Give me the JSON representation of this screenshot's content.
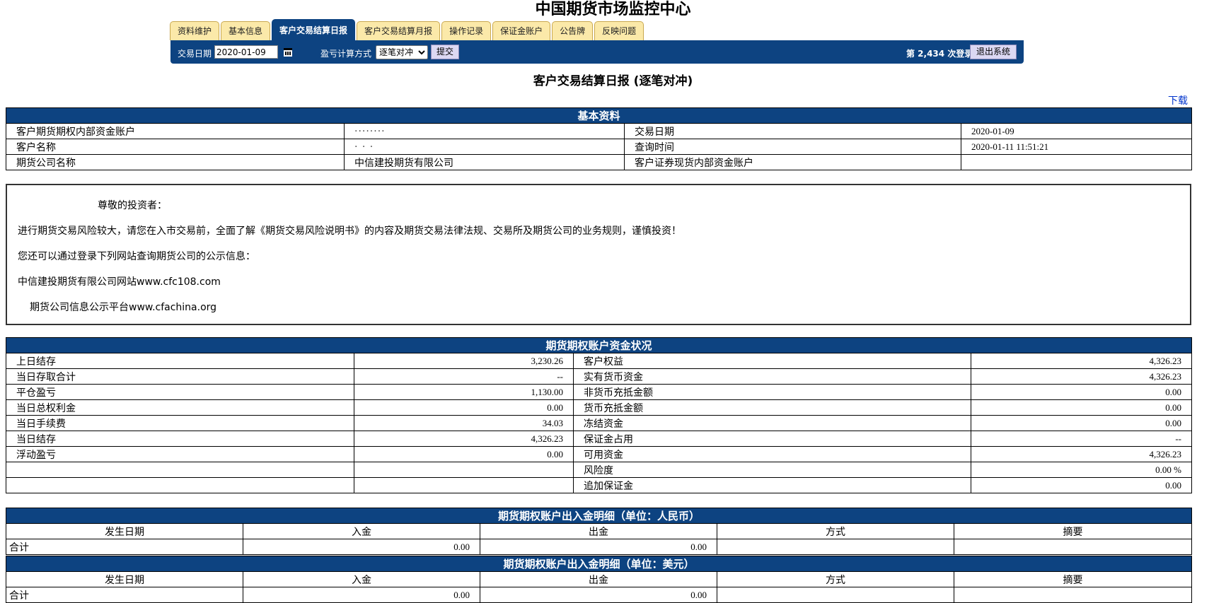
{
  "header": {
    "site_title": "中国期货市场监控中心"
  },
  "tabs": [
    {
      "label": "资料维护"
    },
    {
      "label": "基本信息"
    },
    {
      "label": "客户交易结算日报"
    },
    {
      "label": "客户交易结算月报"
    },
    {
      "label": "操作记录"
    },
    {
      "label": "保证金账户"
    },
    {
      "label": "公告牌"
    },
    {
      "label": "反映问题"
    }
  ],
  "toolbar": {
    "date_label": "交易日期",
    "date_value": "2020-01-09",
    "calc_label": "盈亏计算方式",
    "calc_value": "逐笔对冲",
    "submit_label": "提交",
    "login_count": "第 2,434 次登录",
    "logout_label": "退出系统"
  },
  "report": {
    "title": "客户交易结算日报 (逐笔对冲)",
    "download": "下载"
  },
  "basic": {
    "title": "基本资料",
    "rows": [
      {
        "l1": "客户期货期权内部资金账户",
        "v1": "········",
        "l2": "交易日期",
        "v2": "2020-01-09"
      },
      {
        "l1": "客户名称",
        "v1": "· · ·",
        "l2": "查询时间",
        "v2": "2020-01-11 11:51:21"
      },
      {
        "l1": "期货公司名称",
        "v1": "中信建投期货有限公司",
        "l2": "客户证券现货内部资金账户",
        "v2": ""
      }
    ]
  },
  "notice": {
    "greeting": "尊敬的投资者：",
    "line1": "进行期货交易风险较大，请您在入市交易前，全面了解《期货交易风险说明书》的内容及期货交易法律法规、交易所及期货公司的业务规则，谨慎投资！",
    "line2": "您还可以通过登录下列网站查询期货公司的公示信息：",
    "line3": "中信建投期货有限公司网站www.cfc108.com",
    "line4": "期货公司信息公示平台www.cfachina.org"
  },
  "funds": {
    "title": "期货期权账户资金状况",
    "rows": [
      {
        "l1": "上日结存",
        "v1": "3,230.26",
        "l2": "客户权益",
        "v2": "4,326.23"
      },
      {
        "l1": "当日存取合计",
        "v1": "--",
        "l2": "实有货币资金",
        "v2": "4,326.23"
      },
      {
        "l1": "平仓盈亏",
        "v1": "1,130.00",
        "l2": "非货币充抵金额",
        "v2": "0.00"
      },
      {
        "l1": "当日总权利金",
        "v1": "0.00",
        "l2": "货币充抵金额",
        "v2": "0.00"
      },
      {
        "l1": "当日手续费",
        "v1": "34.03",
        "l2": "冻结资金",
        "v2": "0.00"
      },
      {
        "l1": "当日结存",
        "v1": "4,326.23",
        "l2": "保证金占用",
        "v2": "--"
      },
      {
        "l1": "浮动盈亏",
        "v1": "0.00",
        "l2": "可用资金",
        "v2": "4,326.23"
      },
      {
        "l1": "",
        "v1": "",
        "l2": "风险度",
        "v2": "0.00 %"
      },
      {
        "l1": "",
        "v1": "",
        "l2": "追加保证金",
        "v2": "0.00"
      }
    ]
  },
  "cny_flow": {
    "title": "期货期权账户出入金明细（单位：人民币）",
    "columns": [
      "发生日期",
      "入金",
      "出金",
      "方式",
      "摘要"
    ],
    "total_label": "合计",
    "in_total": "0.00",
    "out_total": "0.00"
  },
  "usd_flow": {
    "title": "期货期权账户出入金明细（单位：美元）",
    "columns": [
      "发生日期",
      "入金",
      "出金",
      "方式",
      "摘要"
    ],
    "total_label": "合计",
    "in_total": "0.00",
    "out_total": "0.00"
  }
}
